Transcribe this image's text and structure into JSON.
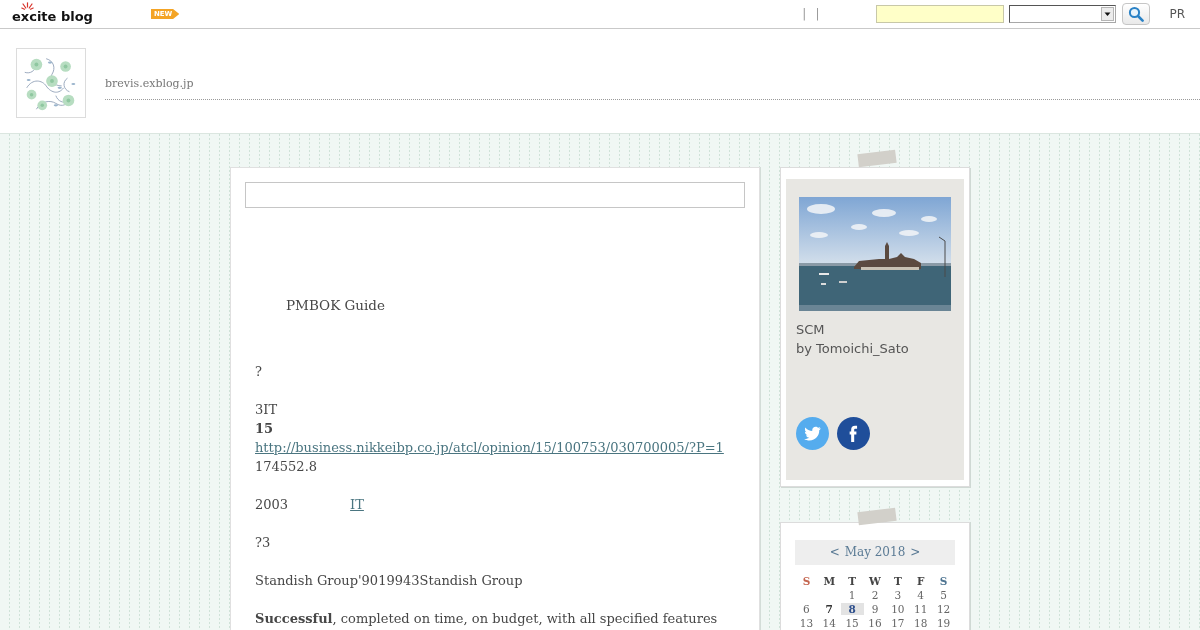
{
  "top_bar": {
    "logo": "excite blog",
    "new_badge": "NEW",
    "separators": [
      "|",
      "|"
    ],
    "pr_label": "PR"
  },
  "header": {
    "blog_url": "brevis.exblog.jp"
  },
  "post": {
    "lead": "PMBOK Guide",
    "paragraphs": [
      [
        [
          {
            "kind": "text",
            "text": "?"
          }
        ]
      ],
      [
        [
          {
            "kind": "text",
            "text": "3IT"
          }
        ],
        [
          {
            "kind": "bold",
            "text": "15"
          }
        ],
        [
          {
            "kind": "link",
            "text": "http://business.nikkeibp.co.jp/atcl/opinion/15/100753/030700005/?P=1"
          }
        ],
        [
          {
            "kind": "text",
            "text": "174552.8"
          }
        ]
      ],
      [
        [
          {
            "kind": "text",
            "text": "2003"
          },
          {
            "kind": "link",
            "text": "IT"
          }
        ]
      ],
      [
        [
          {
            "kind": "text",
            "text": "?3"
          }
        ]
      ],
      [
        [
          {
            "kind": "text",
            "text": "Standish Group'9019943Standish Group"
          }
        ]
      ],
      [
        [
          {
            "kind": "text",
            "text": "**Successful**, completed on time, on budget, with all specified features"
          }
        ]
      ]
    ]
  },
  "sidebar": {
    "profile": {
      "title": "SCM",
      "byline": "by Tomoichi_Sato"
    },
    "calendar": {
      "prev": "<",
      "month": "May 2018",
      "next": ">",
      "weekdays": [
        {
          "label": "S",
          "color": "#c4654f"
        },
        {
          "label": "M",
          "color": "#444444"
        },
        {
          "label": "T",
          "color": "#444444"
        },
        {
          "label": "W",
          "color": "#444444"
        },
        {
          "label": "T",
          "color": "#444444"
        },
        {
          "label": "F",
          "color": "#444444"
        },
        {
          "label": "S",
          "color": "#4f7592"
        }
      ],
      "weeks": [
        [
          {
            "label": "1",
            "linked": false,
            "selected": false
          },
          {
            "label": "2",
            "linked": false,
            "selected": false
          },
          {
            "label": "3",
            "linked": false,
            "selected": false
          },
          {
            "label": "4",
            "linked": false,
            "selected": false
          },
          {
            "label": "5",
            "linked": false,
            "selected": false
          }
        ],
        [
          {
            "label": "6",
            "linked": false,
            "selected": false
          },
          {
            "label": "7",
            "linked": true,
            "selected": false
          },
          {
            "label": "8",
            "linked": true,
            "selected": true
          },
          {
            "label": "9",
            "linked": false,
            "selected": false
          },
          {
            "label": "10",
            "linked": false,
            "selected": false
          },
          {
            "label": "11",
            "linked": false,
            "selected": false
          },
          {
            "label": "12",
            "linked": false,
            "selected": false
          }
        ],
        [
          {
            "label": "13",
            "linked": false,
            "selected": false
          },
          {
            "label": "14",
            "linked": false,
            "selected": false
          },
          {
            "label": "15",
            "linked": false,
            "selected": false
          },
          {
            "label": "16",
            "linked": false,
            "selected": false
          },
          {
            "label": "17",
            "linked": false,
            "selected": false
          },
          {
            "label": "18",
            "linked": false,
            "selected": false
          },
          {
            "label": "19",
            "linked": false,
            "selected": false
          }
        ]
      ]
    }
  }
}
